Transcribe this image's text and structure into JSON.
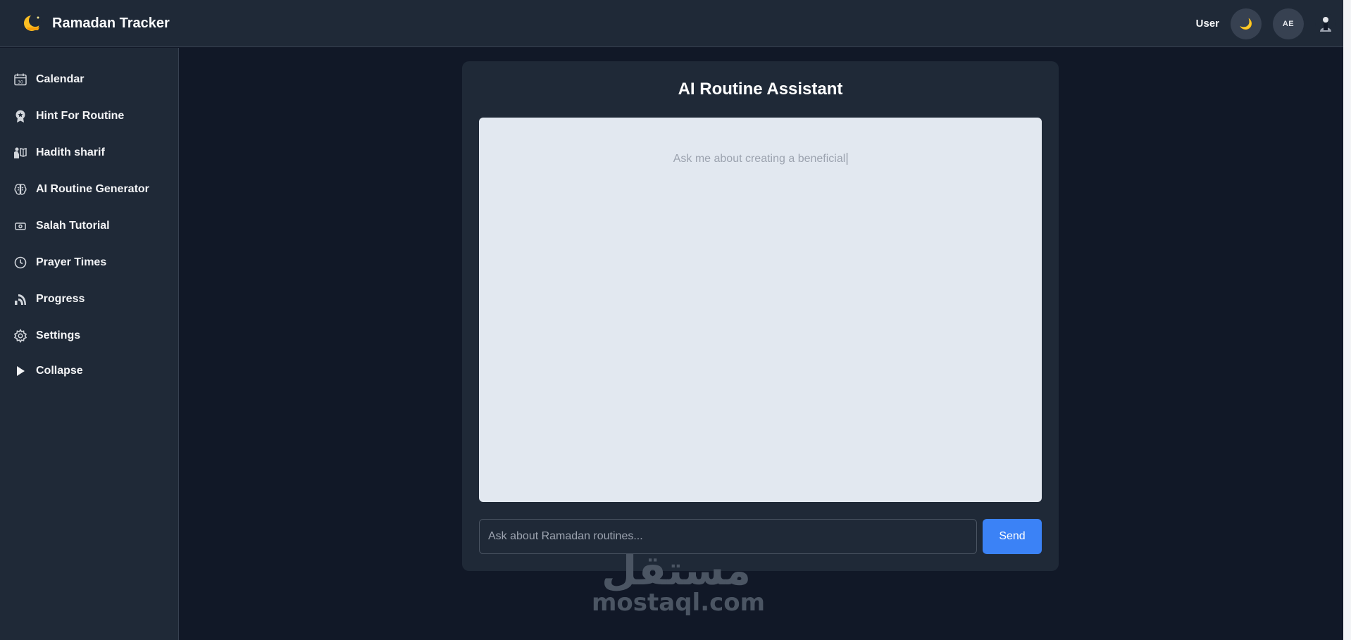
{
  "header": {
    "app_title": "Ramadan Tracker",
    "logo_icon": "crescent-moon-logo-icon",
    "user_label": "User",
    "theme_toggle_glyph": "🌙",
    "avatar_initials": "AE"
  },
  "sidebar": {
    "items": [
      {
        "label": "Calendar",
        "icon": "calendar-icon"
      },
      {
        "label": "Hint For Routine",
        "icon": "badge-icon"
      },
      {
        "label": "Hadith sharif",
        "icon": "book-reader-icon"
      },
      {
        "label": "AI Routine Generator",
        "icon": "brain-icon"
      },
      {
        "label": "Salah Tutorial",
        "icon": "video-icon"
      },
      {
        "label": "Prayer Times",
        "icon": "clock-icon"
      },
      {
        "label": "Progress",
        "icon": "progress-icon"
      },
      {
        "label": "Settings",
        "icon": "gear-icon"
      },
      {
        "label": "Collapse",
        "icon": "play-icon"
      }
    ]
  },
  "assistant": {
    "title": "AI Routine Assistant",
    "chat_placeholder": "Ask me about creating a beneficial",
    "input_placeholder": "Ask about Ramadan routines...",
    "input_value": "",
    "send_label": "Send"
  },
  "watermark": {
    "logo_text": "مستقل",
    "url": "mostaql.com"
  },
  "colors": {
    "background": "#111827",
    "panel": "#1f2937",
    "chat_area": "#e2e8f0",
    "accent": "#3b82f6"
  }
}
